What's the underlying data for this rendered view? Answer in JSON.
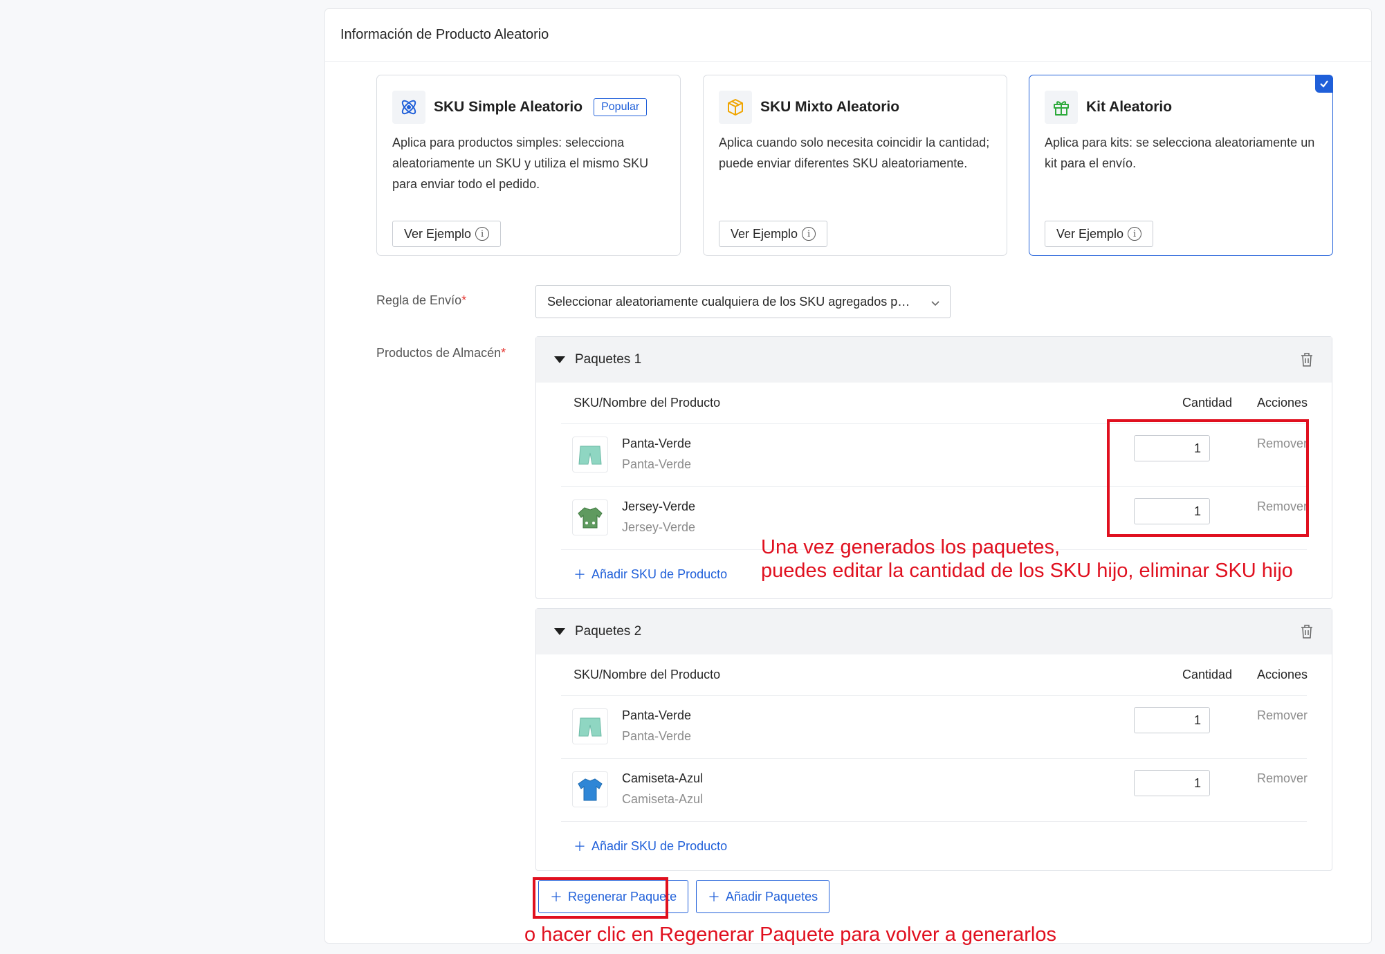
{
  "panel": {
    "title": "Información de Producto Aleatorio"
  },
  "cards": [
    {
      "title": "SKU Simple Aleatorio",
      "badge": "Popular",
      "desc": "Aplica para productos simples: selecciona aleatoriamente un SKU y utiliza el mismo SKU para enviar todo el pedido.",
      "button": "Ver Ejemplo",
      "icon": "atom-icon",
      "selected": false
    },
    {
      "title": "SKU Mixto Aleatorio",
      "desc": "Aplica cuando solo necesita coincidir la cantidad; puede enviar diferentes SKU aleatoriamente.",
      "button": "Ver Ejemplo",
      "icon": "box-icon",
      "selected": false
    },
    {
      "title": "Kit Aleatorio",
      "desc": "Aplica para kits: se selecciona aleatoriamente un kit para el envío.",
      "button": "Ver Ejemplo",
      "icon": "gift-icon",
      "selected": true
    }
  ],
  "form": {
    "shipping_rule_label": "Regla de Envío",
    "shipping_rule_value": "Seleccionar aleatoriamente cualquiera de los SKU agregados p…",
    "warehouse_products_label": "Productos de Almacén",
    "required_mark": "*"
  },
  "packages": [
    {
      "name": "Paquetes 1",
      "columns": {
        "sku": "SKU/Nombre del Producto",
        "qty": "Cantidad",
        "actions": "Acciones"
      },
      "rows": [
        {
          "name": "Panta-Verde",
          "sub": "Panta-Verde",
          "qty": "1",
          "action": "Remover",
          "thumb": "green-shorts-icon"
        },
        {
          "name": "Jersey-Verde",
          "sub": "Jersey-Verde",
          "qty": "1",
          "action": "Remover",
          "thumb": "green-jersey-icon"
        }
      ],
      "add_label": "Añadir SKU de Producto"
    },
    {
      "name": "Paquetes 2",
      "columns": {
        "sku": "SKU/Nombre del Producto",
        "qty": "Cantidad",
        "actions": "Acciones"
      },
      "rows": [
        {
          "name": "Panta-Verde",
          "sub": "Panta-Verde",
          "qty": "1",
          "action": "Remover",
          "thumb": "green-shorts-icon"
        },
        {
          "name": "Camiseta-Azul",
          "sub": "Camiseta-Azul",
          "qty": "1",
          "action": "Remover",
          "thumb": "blue-tshirt-icon"
        }
      ],
      "add_label": "Añadir SKU de Producto"
    }
  ],
  "actions": {
    "regenerate": "Regenerar Paquete",
    "add_packages": "Añadir Paquetes"
  },
  "annotations": {
    "line1": "Una vez generados los paquetes,",
    "line2": "puedes editar la cantidad de los SKU hijo, eliminar SKU hijo",
    "line3": "o hacer clic en Regenerar Paquete para volver a generarlos"
  },
  "colors": {
    "accent": "#1f5fd9",
    "annotation": "#e0101f",
    "required": "#e53935"
  }
}
